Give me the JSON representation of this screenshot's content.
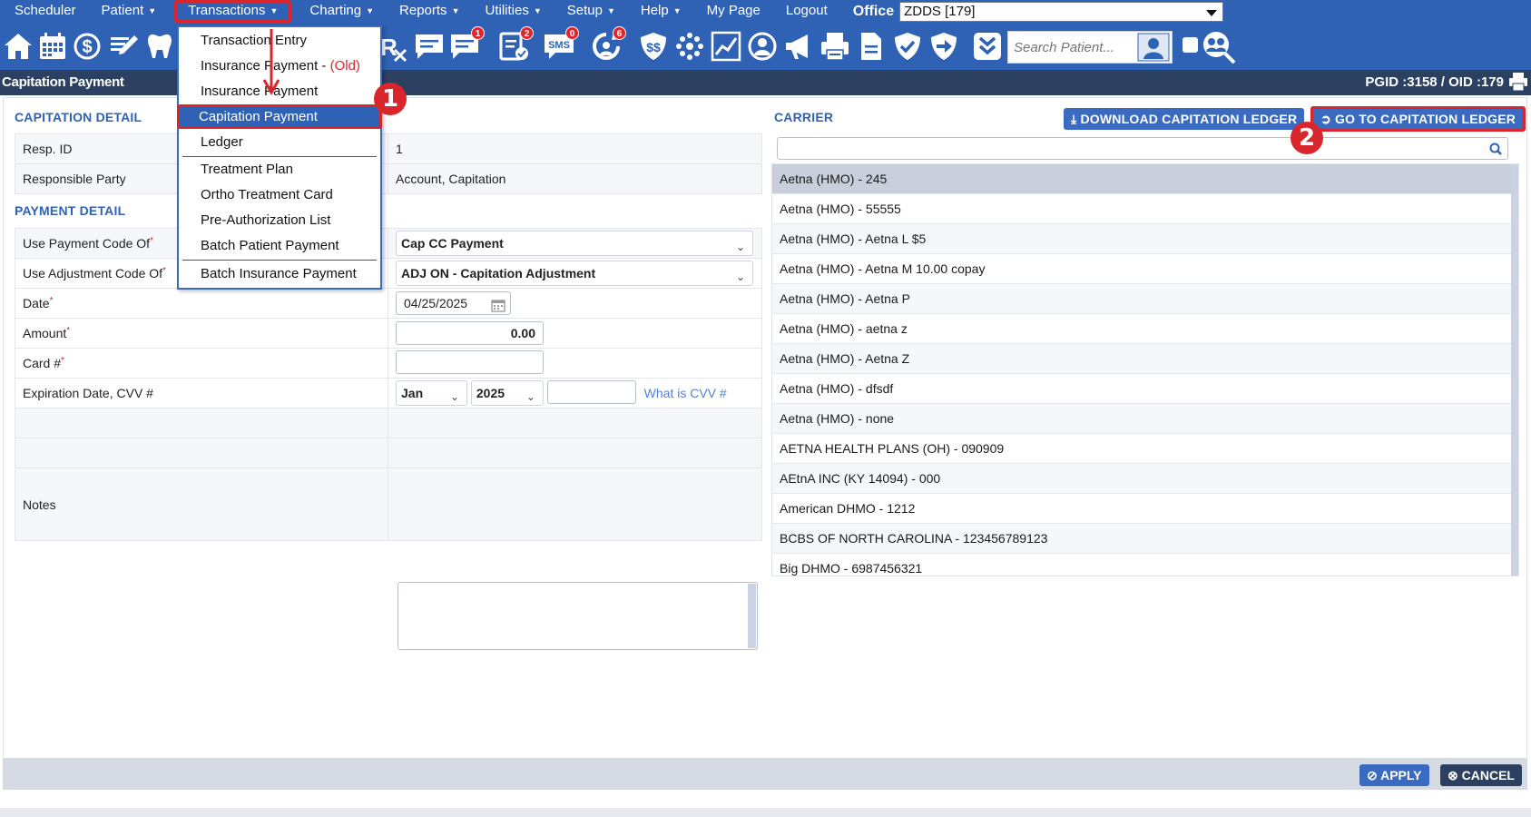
{
  "menubar": {
    "items": [
      {
        "label": "Scheduler",
        "caret": false
      },
      {
        "label": "Patient",
        "caret": true
      },
      {
        "label": "Transactions",
        "caret": true
      },
      {
        "label": "Charting",
        "caret": true
      },
      {
        "label": "Reports",
        "caret": true
      },
      {
        "label": "Utilities",
        "caret": true
      },
      {
        "label": "Setup",
        "caret": true
      },
      {
        "label": "Help",
        "caret": true
      },
      {
        "label": "My Page",
        "caret": false
      },
      {
        "label": "Logout",
        "caret": false
      }
    ],
    "office_label": "Office",
    "office_value": "ZDDS [179]"
  },
  "toolbar": {
    "badges": {
      "messages": "1",
      "forms": "2",
      "sms": "0",
      "recall": "6"
    },
    "search_placeholder": "Search Patient...",
    "sms_text": "SMS",
    "rx_text": "Rx"
  },
  "titlebar": {
    "title": "Capitation Payment",
    "ids": "PGID :3158  /  OID :179"
  },
  "dropdown": {
    "items": [
      {
        "label": "Transaction Entry"
      },
      {
        "label": "Insurance Payment - ",
        "tag": "(Old)"
      },
      {
        "label": "Insurance Payment"
      },
      {
        "label": "Capitation Payment"
      },
      {
        "label": "Ledger"
      },
      {
        "label": "Treatment Plan"
      },
      {
        "label": "Ortho Treatment Card"
      },
      {
        "label": "Pre-Authorization List"
      },
      {
        "label": "Batch Patient Payment"
      },
      {
        "label": "Batch Insurance Payment"
      }
    ]
  },
  "capitation_detail": {
    "title": "CAPITATION DETAIL",
    "resp_id_label": "Resp. ID",
    "resp_id_value": "1",
    "party_label": "Responsible Party",
    "party_value": "Account, Capitation"
  },
  "payment_detail": {
    "title": "PAYMENT DETAIL",
    "payment_code_label": "Use Payment Code Of",
    "payment_code_value": "Cap CC Payment",
    "adjustment_code_label": "Use Adjustment Code Of",
    "adjustment_code_value": "ADJ ON - Capitation Adjustment",
    "date_label": "Date",
    "date_value": "04/25/2025",
    "amount_label": "Amount",
    "amount_value": "0.00",
    "card_label": "Card #",
    "card_value": "",
    "exp_label": "Expiration Date, CVV #",
    "exp_month": "Jan",
    "exp_year": "2025",
    "cvv_value": "",
    "cvv_link": "What is CVV #",
    "notes_label": "Notes",
    "required_mark": "*"
  },
  "carrier": {
    "title": "CARRIER",
    "download_button": "DOWNLOAD CAPITATION LEDGER",
    "goto_button": "GO TO CAPITATION LEDGER",
    "search_value": "",
    "list": [
      "Aetna (HMO) - 245",
      "Aetna (HMO) - 55555",
      "Aetna (HMO) - Aetna L $5",
      "Aetna (HMO) - Aetna M 10.00 copay",
      "Aetna (HMO) - Aetna P",
      "Aetna (HMO) - aetna z",
      "Aetna (HMO) - Aetna Z",
      "Aetna (HMO) - dfsdf",
      "Aetna (HMO) - none",
      "AETNA HEALTH PLANS (OH) - 090909",
      "AEtnA INC (KY 14094) - 000",
      "American DHMO - 1212",
      "BCBS OF NORTH CAROLINA - 123456789123",
      "Big DHMO - 6987456321"
    ]
  },
  "footer": {
    "apply_label": "APPLY",
    "cancel_label": "CANCEL"
  },
  "annotations": {
    "step1": "1",
    "step2": "2"
  },
  "colors": {
    "menubar": "#2f62b4",
    "titlebar": "#2c4161",
    "highlight": "#d8262c",
    "section_title": "#2f62b4",
    "cancel_button": "#2c4161",
    "apply_button": "#3a6bc0"
  }
}
